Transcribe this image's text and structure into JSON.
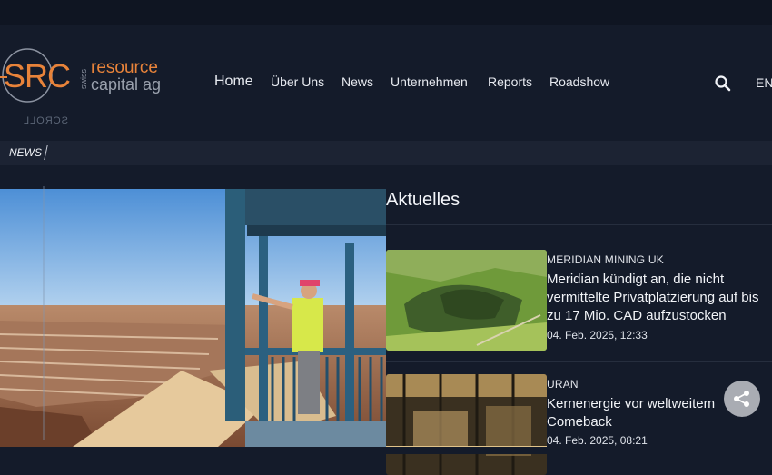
{
  "brand": {
    "logo_letters": "SRC",
    "logo_swiss": "swiss",
    "logo_line1": "resource",
    "logo_line2": "capital ag"
  },
  "nav": {
    "items": [
      {
        "label": "Home"
      },
      {
        "label": "Über Uns"
      },
      {
        "label": "News"
      },
      {
        "label": "Unternehmen"
      },
      {
        "label": "Reports"
      },
      {
        "label": "Roadshow"
      }
    ],
    "search_icon": "search-icon",
    "language": "EN"
  },
  "scroll_label": "SCROLL",
  "ticker": {
    "label": "NEWS"
  },
  "section": {
    "title": "Aktuelles"
  },
  "articles": [
    {
      "category": "MERIDIAN MINING UK",
      "title": "Meridian kündigt an, die nicht vermittelte Privatplatzierung auf bis zu 17 Mio. CAD aufzustocken",
      "date": "04. Feb. 2025, 12:33"
    },
    {
      "category": "URAN",
      "title": "Kernenergie vor weltweitem Comeback",
      "date": "04. Feb. 2025, 08:21"
    }
  ],
  "share": {
    "icon": "share-icon"
  },
  "colors": {
    "background": "#141b2a",
    "logo_orange": "#e8833a",
    "text": "#e8ebf1"
  }
}
